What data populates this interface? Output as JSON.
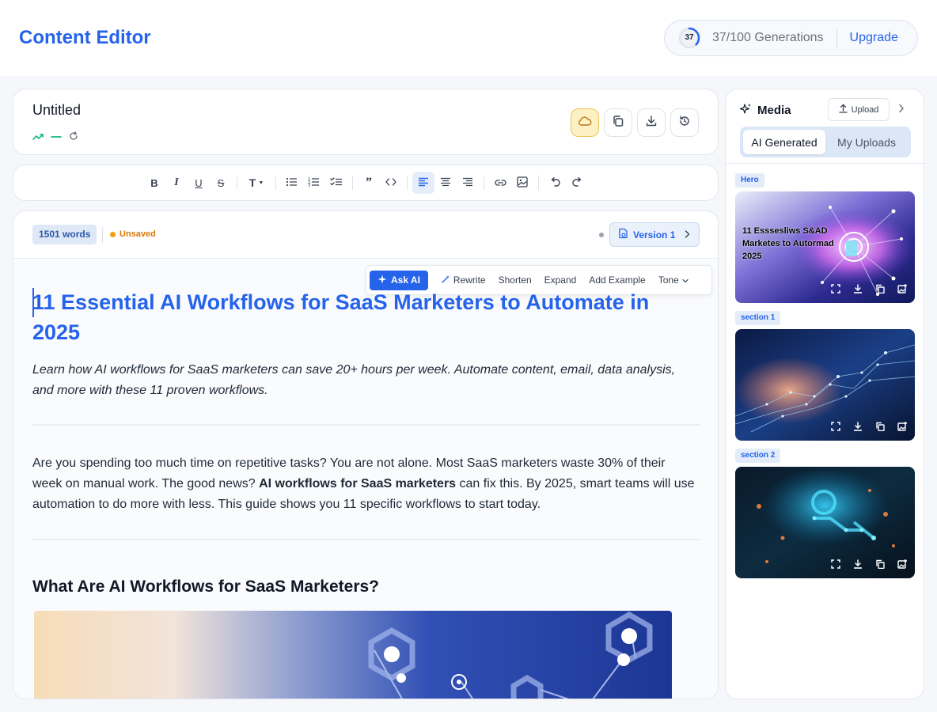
{
  "header": {
    "title": "Content Editor",
    "generations": {
      "used": 37,
      "total": 100,
      "ring_label": "37",
      "label": "37/100 Generations"
    },
    "upgrade_label": "Upgrade"
  },
  "document": {
    "title": "Untitled",
    "actions": [
      "cloud-save-icon",
      "copy-icon",
      "download-icon",
      "history-icon"
    ]
  },
  "editor": {
    "word_count": "1501 words",
    "save_status": "Unsaved",
    "version_label": "Version 1",
    "ai_bar": {
      "ask_ai": "Ask AI",
      "rewrite": "Rewrite",
      "shorten": "Shorten",
      "expand": "Expand",
      "add_example": "Add Example",
      "tone": "Tone"
    },
    "heading": "11 Essential AI Workflows for SaaS Marketers to Automate in 2025",
    "lede": "Learn how AI workflows for SaaS marketers can save 20+ hours per week. Automate content, email, data analysis, and more with these 11 proven workflows.",
    "para_part1": "Are you spending too much time on repetitive tasks? You are not alone. Most SaaS marketers waste 30% of their week on manual work. The good news? ",
    "para_bold": "AI workflows for SaaS marketers",
    "para_part2": " can fix this. By 2025, smart teams will use automation to do more with less. This guide shows you 11 specific workflows to start today.",
    "h2": "What Are AI Workflows for SaaS Marketers?"
  },
  "media": {
    "title": "Media",
    "upload_label": "Upload",
    "tabs": [
      "AI Generated",
      "My Uploads"
    ],
    "active_tab": "AI Generated",
    "items": [
      {
        "tag": "Hero",
        "overlay": "11 Esssesliws S&AD Marketes to Autormad 2025"
      },
      {
        "tag": "section 1"
      },
      {
        "tag": "section 2"
      }
    ]
  },
  "colors": {
    "accent": "#2563eb",
    "warning": "#d97706",
    "save_active": "#fdf0c2"
  }
}
